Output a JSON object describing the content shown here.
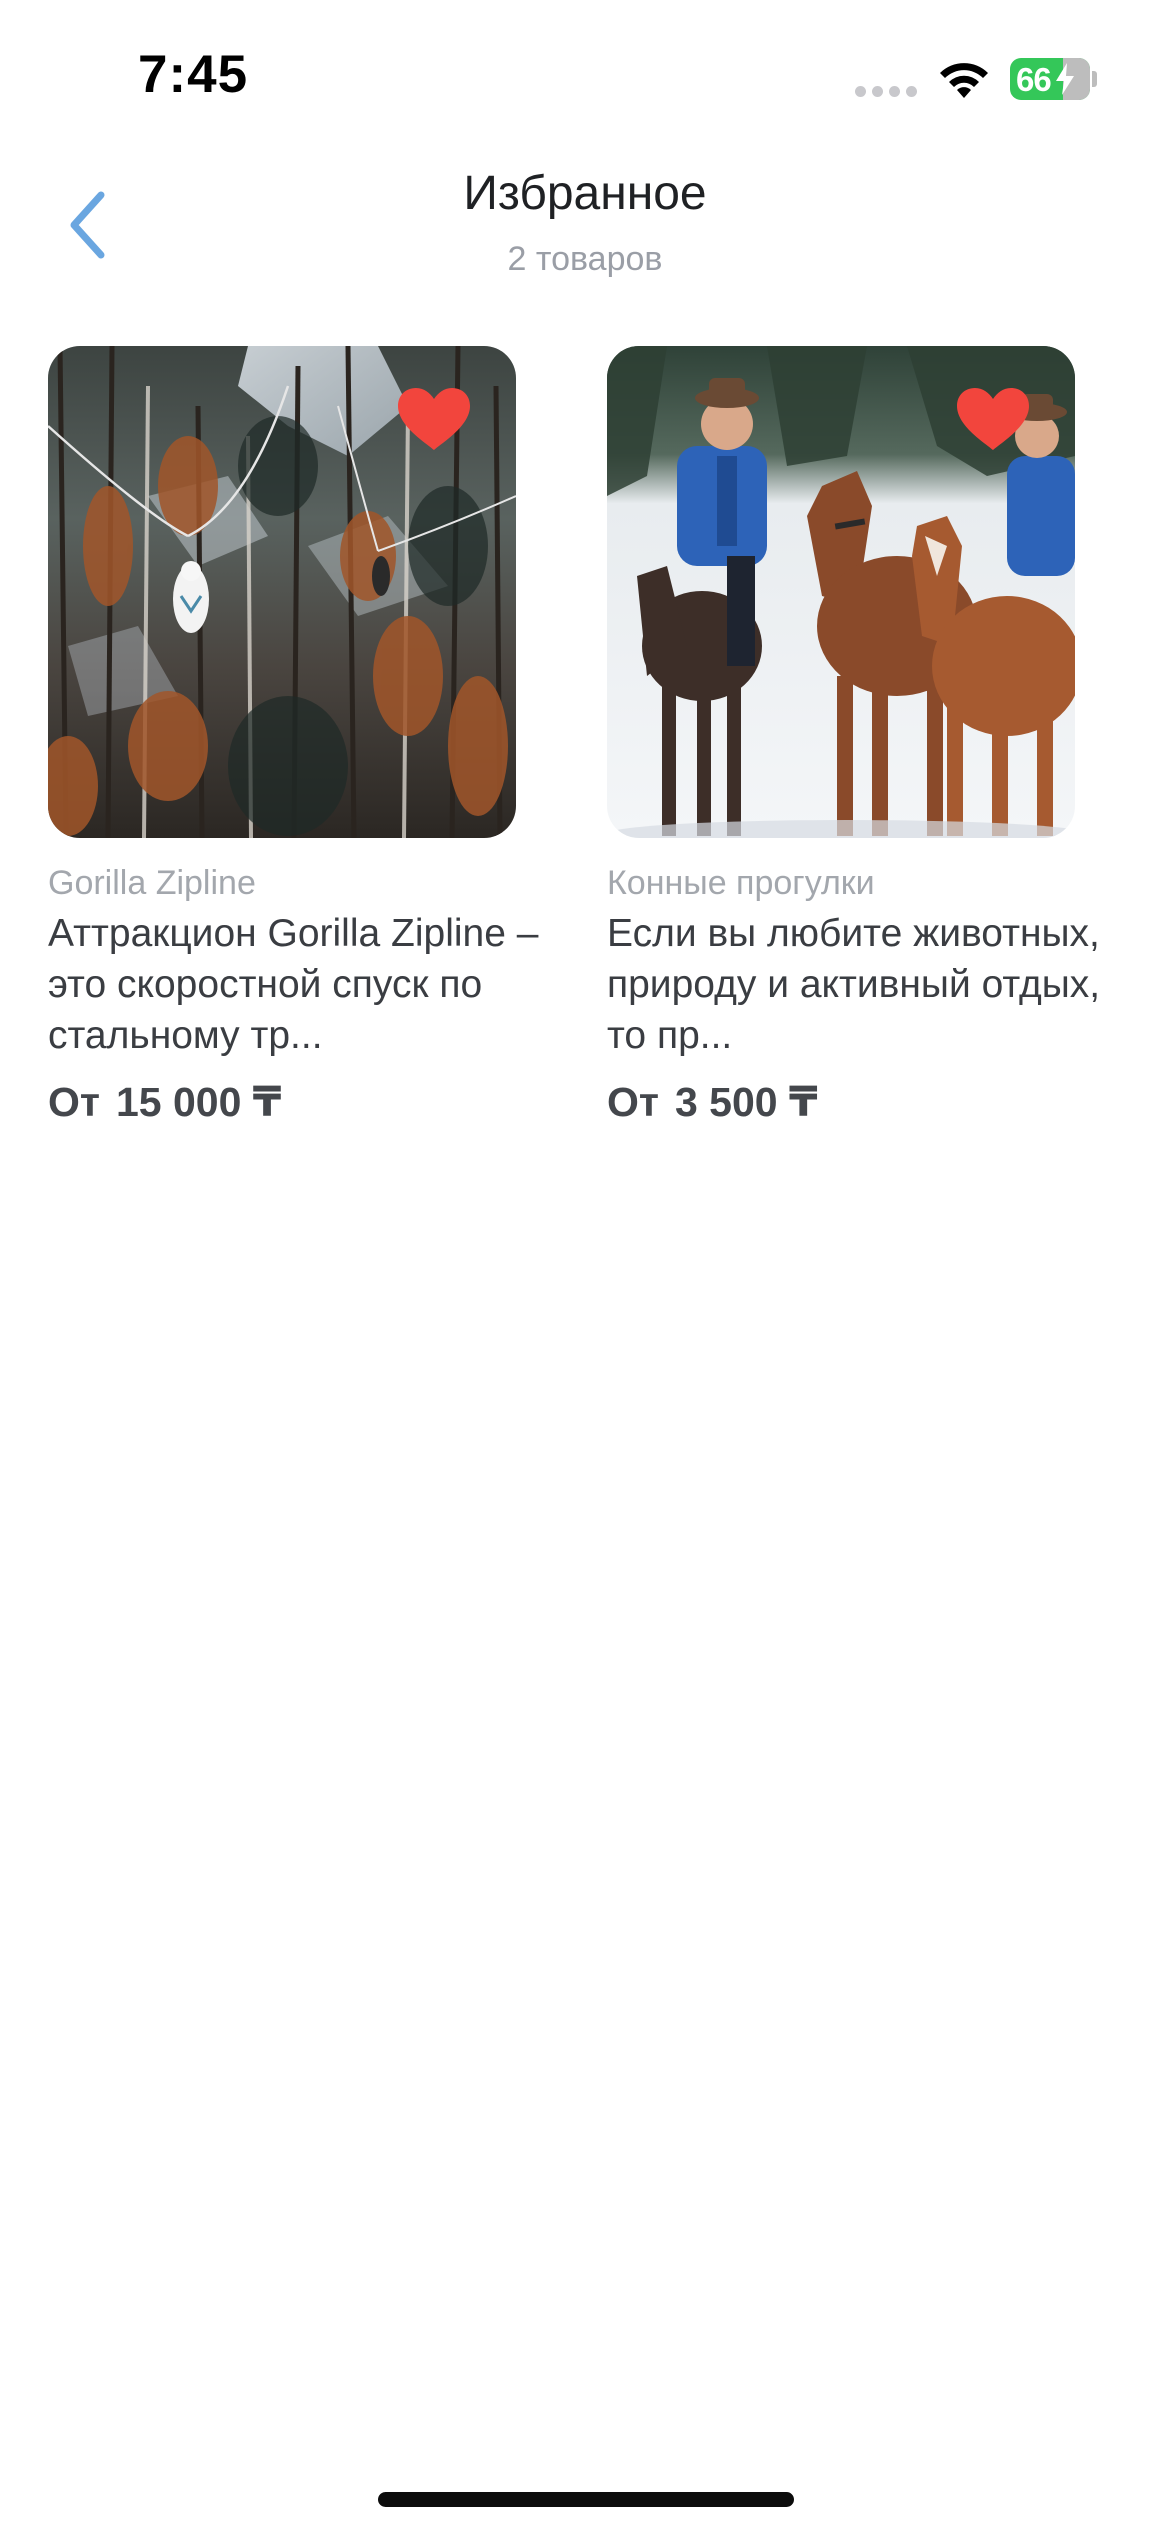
{
  "status_bar": {
    "time": "7:45",
    "battery_level": "66",
    "battery_color": "#34c759"
  },
  "header": {
    "back_icon": "chevron-left-icon",
    "title": "Избранное",
    "subtitle": "2 товаров",
    "accent_color": "#6aa6e0"
  },
  "products": [
    {
      "category": "Gorilla Zipline",
      "description": "Аттракцион Gorilla Zipline – это скоростной спуск по стальному тр...",
      "price_prefix": "От",
      "price": "15 000 ₸",
      "favorite": true,
      "image_icon": "zipline-forest-photo"
    },
    {
      "category": "Конные прогулки",
      "description": "Если вы любите животных, природу и активный отдых, то пр...",
      "price_prefix": "От",
      "price": "3 500 ₸",
      "favorite": true,
      "image_icon": "horses-snow-photo"
    }
  ],
  "favorite_icon": "heart-icon",
  "favorite_color": "#f2453d"
}
